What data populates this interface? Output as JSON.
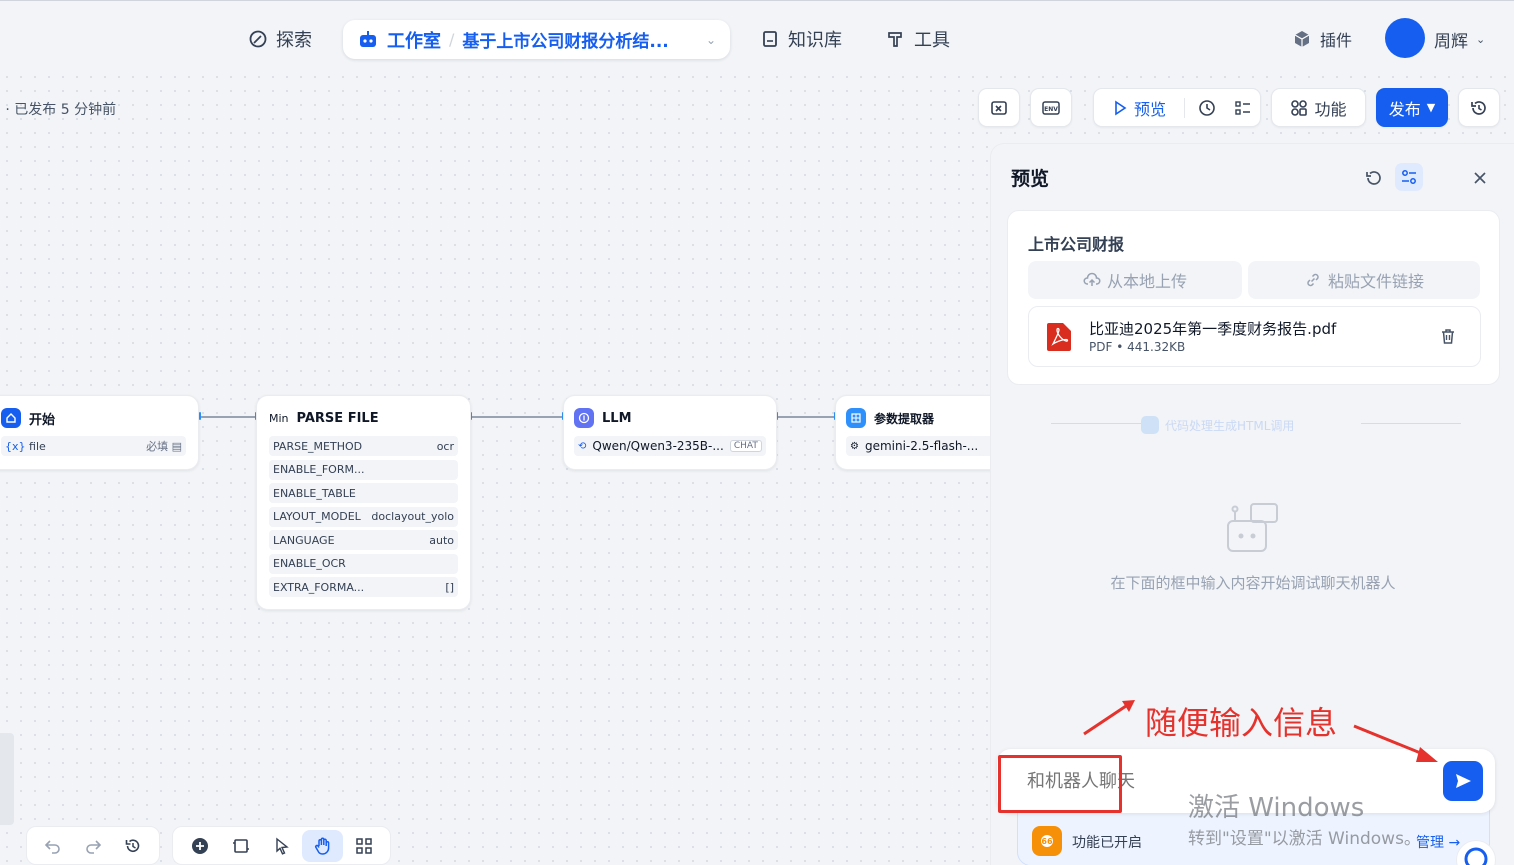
{
  "nav": {
    "explore": "探索",
    "studio": "工作室",
    "app_name": "基于上市公司财报分析结...",
    "knowledge": "知识库",
    "tools": "工具",
    "plugins": "插件",
    "user": "周辉"
  },
  "status": "5 · 已发布 5 分钟前",
  "toolbar": {
    "preview": "预览",
    "features": "功能",
    "publish": "发布"
  },
  "nodes": {
    "start": {
      "title": "开始",
      "var": "file",
      "required": "必填"
    },
    "parse": {
      "prefix": "Min",
      "title": "PARSE FILE",
      "fields": [
        {
          "k": "PARSE_METHOD",
          "v": "ocr"
        },
        {
          "k": "ENABLE_FORM...",
          "v": ""
        },
        {
          "k": "ENABLE_TABLE",
          "v": ""
        },
        {
          "k": "LAYOUT_MODEL",
          "v": "doclayout_yolo"
        },
        {
          "k": "LANGUAGE",
          "v": "auto"
        },
        {
          "k": "ENABLE_OCR",
          "v": ""
        },
        {
          "k": "EXTRA_FORMA...",
          "v": "[]"
        }
      ]
    },
    "llm": {
      "title": "LLM",
      "model": "Qwen/Qwen3-235B-...",
      "mode": "CHAT"
    },
    "extractor": {
      "title": "参数提取器",
      "model": "gemini-2.5-flash-..."
    },
    "code": {
      "title": "代码处理生成HTML调用"
    }
  },
  "panel": {
    "title": "预览",
    "section_title": "上市公司财报",
    "upload_local": "从本地上传",
    "paste_link": "粘贴文件链接",
    "file_name": "比亚迪2025年第一季度财务报告.pdf",
    "file_type": "PDF",
    "file_size": "441.32KB",
    "empty_hint": "在下面的框中输入内容开始调试聊天机器人",
    "chat_placeholder": "和机器人聊天",
    "features_on": "功能已开启",
    "manage": "管理"
  },
  "annotation": "随便输入信息",
  "watermark": {
    "line1": "激活 Windows",
    "line2": "转到\"设置\"以激活 Windows。"
  },
  "colors": {
    "accent": "#155eef",
    "annotation": "#e5322d"
  }
}
